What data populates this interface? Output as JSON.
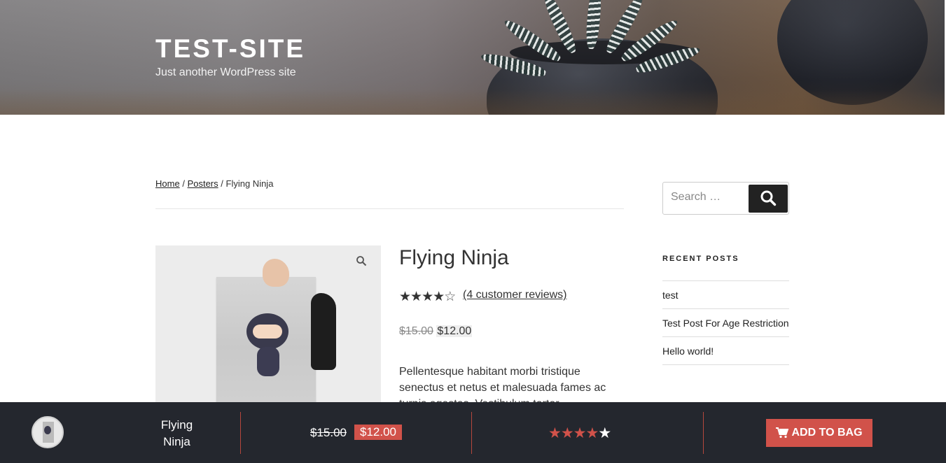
{
  "header": {
    "site_title": "TEST-SITE",
    "site_description": "Just another WordPress site"
  },
  "breadcrumb": {
    "home": "Home",
    "separator1": "/",
    "posters": "Posters",
    "separator2": "/",
    "current": "Flying Ninja"
  },
  "product": {
    "title": "Flying Ninja",
    "rating": 4,
    "rating_max": 5,
    "review_link": "(4 customer reviews)",
    "regular_price": "$15.00",
    "sale_price": "$12.00",
    "description": "Pellentesque habitant morbi tristique senectus et netus et malesuada fames ac turpis egestas. Vestibulum tortor"
  },
  "sidebar": {
    "search_placeholder": "Search …",
    "recent_posts_title": "RECENT POSTS",
    "recent_posts": [
      "test",
      "Test Post For Age Restriction",
      "Hello world!"
    ]
  },
  "sticky_bar": {
    "name": "Flying Ninja",
    "regular_price": "$15.00",
    "sale_price": "$12.00",
    "rating": 4,
    "add_label": "ADD TO BAG"
  },
  "colors": {
    "accent": "#d1524a",
    "bar_background": "#24272e"
  }
}
